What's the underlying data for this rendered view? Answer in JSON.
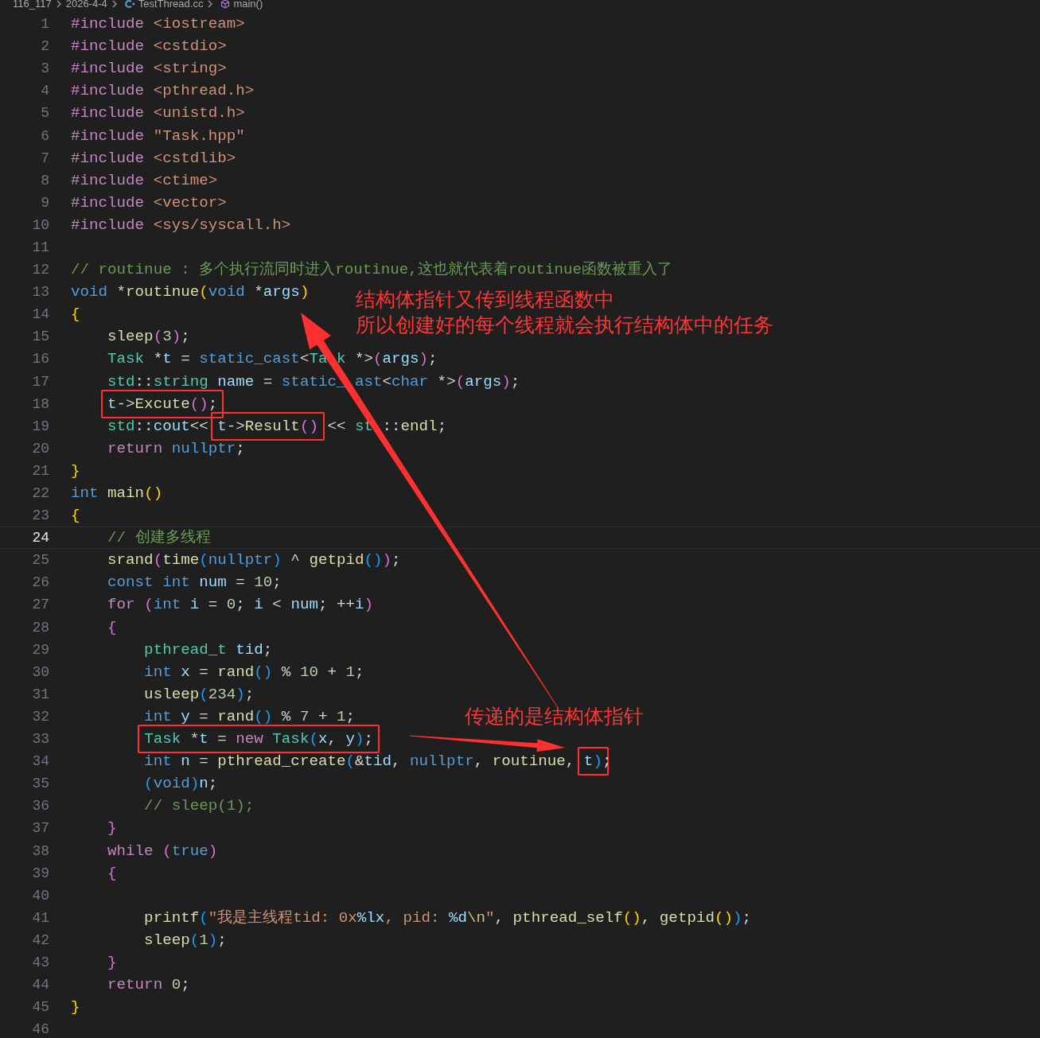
{
  "breadcrumb": [
    {
      "kind": "folder",
      "text": "116_117"
    },
    {
      "kind": "folder",
      "text": "2026-4-4"
    },
    {
      "kind": "file",
      "text": "TestThread.cc"
    },
    {
      "kind": "symbol",
      "text": "main()"
    }
  ],
  "lines": [
    {
      "number": "1",
      "selected": false,
      "tokens": [
        {
          "kind": "control",
          "text": "#include "
        },
        {
          "kind": "string",
          "text": "<iostream>"
        }
      ]
    },
    {
      "number": "2",
      "selected": false,
      "tokens": [
        {
          "kind": "control",
          "text": "#include "
        },
        {
          "kind": "string",
          "text": "<cstdio>"
        }
      ]
    },
    {
      "number": "3",
      "selected": false,
      "tokens": [
        {
          "kind": "control",
          "text": "#include "
        },
        {
          "kind": "string",
          "text": "<string>"
        }
      ]
    },
    {
      "number": "4",
      "selected": false,
      "tokens": [
        {
          "kind": "control",
          "text": "#include "
        },
        {
          "kind": "string",
          "text": "<pthread.h>"
        }
      ]
    },
    {
      "number": "5",
      "selected": false,
      "tokens": [
        {
          "kind": "control",
          "text": "#include "
        },
        {
          "kind": "string",
          "text": "<unistd.h>"
        }
      ]
    },
    {
      "number": "6",
      "selected": false,
      "tokens": [
        {
          "kind": "control",
          "text": "#include "
        },
        {
          "kind": "string",
          "text": "\"Task.hpp\""
        }
      ]
    },
    {
      "number": "7",
      "selected": false,
      "tokens": [
        {
          "kind": "control",
          "text": "#include "
        },
        {
          "kind": "string",
          "text": "<cstdlib>"
        }
      ]
    },
    {
      "number": "8",
      "selected": false,
      "tokens": [
        {
          "kind": "control",
          "text": "#include "
        },
        {
          "kind": "string",
          "text": "<ctime>"
        }
      ]
    },
    {
      "number": "9",
      "selected": false,
      "tokens": [
        {
          "kind": "control",
          "text": "#include "
        },
        {
          "kind": "string",
          "text": "<vector>"
        }
      ]
    },
    {
      "number": "10",
      "selected": false,
      "tokens": [
        {
          "kind": "control",
          "text": "#include "
        },
        {
          "kind": "string",
          "text": "<sys/syscall.h>"
        }
      ]
    },
    {
      "number": "11",
      "selected": false
    },
    {
      "number": "12",
      "selected": false,
      "tokens": [
        {
          "kind": "comment",
          "text": "// routinue : 多个执行流同时进入routinue,这也就代表着routinue函数被重入了"
        }
      ]
    },
    {
      "number": "13",
      "selected": false,
      "tokens": [
        {
          "kind": "keyword",
          "text": "void"
        },
        {
          "kind": "plain",
          "text": " *"
        },
        {
          "kind": "function",
          "text": "routinue"
        },
        {
          "kind": "bracket1",
          "text": "("
        },
        {
          "kind": "keyword",
          "text": "void"
        },
        {
          "kind": "plain",
          "text": " *"
        },
        {
          "kind": "variable",
          "text": "args"
        },
        {
          "kind": "bracket1",
          "text": ")"
        }
      ]
    },
    {
      "number": "14",
      "selected": false,
      "tokens": [
        {
          "kind": "bracket1",
          "text": "{"
        }
      ]
    },
    {
      "number": "15",
      "selected": false,
      "tokens": [
        {
          "kind": "function",
          "text": "    sleep"
        },
        {
          "kind": "bracket2",
          "text": "("
        },
        {
          "kind": "number",
          "text": "3"
        },
        {
          "kind": "bracket2",
          "text": ")"
        },
        {
          "kind": "plain",
          "text": ";"
        }
      ]
    },
    {
      "number": "16",
      "selected": false,
      "tokens": [
        {
          "kind": "type",
          "text": "    Task"
        },
        {
          "kind": "plain",
          "text": " *"
        },
        {
          "kind": "variable",
          "text": "t"
        },
        {
          "kind": "plain",
          "text": " = "
        },
        {
          "kind": "keyword",
          "text": "static_cast"
        },
        {
          "kind": "plain",
          "text": "<"
        },
        {
          "kind": "type",
          "text": "Ta"
        },
        {
          "kind": "type",
          "text": " k"
        },
        {
          "kind": "plain",
          "text": " *>"
        },
        {
          "kind": "bracket2",
          "text": "("
        },
        {
          "kind": "variable",
          "text": "args"
        },
        {
          "kind": "bracket2",
          "text": ")"
        },
        {
          "kind": "plain",
          "text": ";"
        }
      ]
    },
    {
      "number": "17",
      "selected": false,
      "tokens": [
        {
          "kind": "type",
          "text": "    std"
        },
        {
          "kind": "plain",
          "text": "::"
        },
        {
          "kind": "type",
          "text": "string "
        },
        {
          "kind": "variable",
          "text": "name"
        },
        {
          "kind": "plain",
          "text": " = "
        },
        {
          "kind": "keyword",
          "text": "static_"
        },
        {
          "kind": "keyword",
          "text": " ast"
        },
        {
          "kind": "plain",
          "text": "<"
        },
        {
          "kind": "keyword",
          "text": "char"
        },
        {
          "kind": "plain",
          "text": " *>"
        },
        {
          "kind": "bracket2",
          "text": "("
        },
        {
          "kind": "variable",
          "text": "args"
        },
        {
          "kind": "bracket2",
          "text": ")"
        },
        {
          "kind": "plain",
          "text": ";"
        }
      ]
    },
    {
      "number": "18",
      "selected": false,
      "segments": [
        {
          "framed": true,
          "tokens": [
            {
              "kind": "variable",
              "text": "    t"
            },
            {
              "kind": "plain",
              "text": "->"
            },
            {
              "kind": "function",
              "text": "Excute"
            },
            {
              "kind": "bracket2",
              "text": "()"
            },
            {
              "kind": "plain",
              "text": ";"
            }
          ]
        }
      ]
    },
    {
      "number": "19",
      "selected": false,
      "segments": [
        {
          "tokens": [
            {
              "kind": "type",
              "text": "    std"
            },
            {
              "kind": "plain",
              "text": "::"
            },
            {
              "kind": "variable",
              "text": "cout"
            },
            {
              "kind": "plain",
              "text": "<< "
            }
          ]
        },
        {
          "framed": true,
          "tokens": [
            {
              "kind": "variable",
              "text": "t"
            },
            {
              "kind": "plain",
              "text": "->"
            },
            {
              "kind": "function",
              "text": "Result"
            },
            {
              "kind": "bracket2",
              "text": "()"
            }
          ]
        },
        {
          "tokens": [
            {
              "kind": "plain",
              "text": " << "
            },
            {
              "kind": "type",
              "text": "st"
            },
            {
              "kind": "plain",
              "text": " ::"
            },
            {
              "kind": "function",
              "text": "endl"
            },
            {
              "kind": "plain",
              "text": ";"
            }
          ]
        }
      ]
    },
    {
      "number": "20",
      "selected": false,
      "tokens": [
        {
          "kind": "control",
          "text": "    return "
        },
        {
          "kind": "keyword",
          "text": "nullptr"
        },
        {
          "kind": "plain",
          "text": ";"
        }
      ]
    },
    {
      "number": "21",
      "selected": false,
      "tokens": [
        {
          "kind": "bracket1",
          "text": "}"
        }
      ]
    },
    {
      "number": "22",
      "selected": false,
      "tokens": [
        {
          "kind": "keyword",
          "text": "int "
        },
        {
          "kind": "function",
          "text": "main"
        },
        {
          "kind": "bracket1",
          "text": "()"
        }
      ]
    },
    {
      "number": "23",
      "selected": false,
      "tokens": [
        {
          "kind": "bracket1",
          "text": "{"
        }
      ]
    },
    {
      "number": "24",
      "selected": true,
      "tokens": [
        {
          "kind": "comment",
          "text": "    // 创建多线程"
        }
      ]
    },
    {
      "number": "25",
      "selected": false,
      "tokens": [
        {
          "kind": "function",
          "text": "    srand"
        },
        {
          "kind": "bracket2",
          "text": "("
        },
        {
          "kind": "function",
          "text": "time"
        },
        {
          "kind": "bracket3",
          "text": "("
        },
        {
          "kind": "keyword",
          "text": "nullptr"
        },
        {
          "kind": "bracket3",
          "text": ")"
        },
        {
          "kind": "plain",
          "text": " ^ "
        },
        {
          "kind": "function",
          "text": "getpid"
        },
        {
          "kind": "bracket3",
          "text": "()"
        },
        {
          "kind": "bracket2",
          "text": ")"
        },
        {
          "kind": "plain",
          "text": ";"
        }
      ]
    },
    {
      "number": "26",
      "selected": false,
      "tokens": [
        {
          "kind": "keyword",
          "text": "    const "
        },
        {
          "kind": "keyword",
          "text": "int "
        },
        {
          "kind": "variable",
          "text": "num"
        },
        {
          "kind": "plain",
          "text": " = "
        },
        {
          "kind": "number",
          "text": "10"
        },
        {
          "kind": "plain",
          "text": ";"
        }
      ]
    },
    {
      "number": "27",
      "selected": false,
      "tokens": [
        {
          "kind": "control",
          "text": "    for "
        },
        {
          "kind": "bracket2",
          "text": "("
        },
        {
          "kind": "keyword",
          "text": "int "
        },
        {
          "kind": "variable",
          "text": "i"
        },
        {
          "kind": "plain",
          "text": " = "
        },
        {
          "kind": "number",
          "text": "0"
        },
        {
          "kind": "plain",
          "text": "; "
        },
        {
          "kind": "variable",
          "text": "i"
        },
        {
          "kind": "plain",
          "text": " < "
        },
        {
          "kind": "variable",
          "text": "num"
        },
        {
          "kind": "plain",
          "text": "; ++"
        },
        {
          "kind": "variable",
          "text": "i"
        },
        {
          "kind": "bracket2",
          "text": ")"
        }
      ]
    },
    {
      "number": "28",
      "selected": false,
      "tokens": [
        {
          "kind": "bracket2",
          "text": "    {"
        }
      ]
    },
    {
      "number": "29",
      "selected": false,
      "tokens": [
        {
          "kind": "type",
          "text": "        pthread_t "
        },
        {
          "kind": "variable",
          "text": "tid"
        },
        {
          "kind": "plain",
          "text": ";"
        }
      ]
    },
    {
      "number": "30",
      "selected": false,
      "tokens": [
        {
          "kind": "keyword",
          "text": "        int "
        },
        {
          "kind": "variable",
          "text": "x"
        },
        {
          "kind": "plain",
          "text": " = "
        },
        {
          "kind": "function",
          "text": "rand"
        },
        {
          "kind": "bracket3",
          "text": "()"
        },
        {
          "kind": "plain",
          "text": " % "
        },
        {
          "kind": "number",
          "text": "10"
        },
        {
          "kind": "plain",
          "text": " + "
        },
        {
          "kind": "number",
          "text": "1"
        },
        {
          "kind": "plain",
          "text": ";"
        }
      ]
    },
    {
      "number": "31",
      "selected": false,
      "tokens": [
        {
          "kind": "function",
          "text": "        usleep"
        },
        {
          "kind": "bracket3",
          "text": "("
        },
        {
          "kind": "number",
          "text": "234"
        },
        {
          "kind": "bracket3",
          "text": ")"
        },
        {
          "kind": "plain",
          "text": ";"
        }
      ]
    },
    {
      "number": "32",
      "selected": false,
      "tokens": [
        {
          "kind": "keyword",
          "text": "        int "
        },
        {
          "kind": "variable",
          "text": "y"
        },
        {
          "kind": "plain",
          "text": " = "
        },
        {
          "kind": "function",
          "text": "rand"
        },
        {
          "kind": "bracket3",
          "text": "()"
        },
        {
          "kind": "plain",
          "text": " % "
        },
        {
          "kind": "number",
          "text": "7"
        },
        {
          "kind": "plain",
          "text": " + "
        },
        {
          "kind": "number",
          "text": "1"
        },
        {
          "kind": "plain",
          "text": ";"
        }
      ]
    },
    {
      "number": "33",
      "selected": false,
      "segments": [
        {
          "framed": true,
          "tokens": [
            {
              "kind": "type",
              "text": "        Task"
            },
            {
              "kind": "plain",
              "text": " *"
            },
            {
              "kind": "variable",
              "text": "t"
            },
            {
              "kind": "plain",
              "text": " = "
            },
            {
              "kind": "control",
              "text": "new "
            },
            {
              "kind": "type",
              "text": "Task"
            },
            {
              "kind": "bracket3",
              "text": "("
            },
            {
              "kind": "variable",
              "text": "x"
            },
            {
              "kind": "plain",
              "text": ", "
            },
            {
              "kind": "variable",
              "text": "y"
            },
            {
              "kind": "bracket3",
              "text": ")"
            },
            {
              "kind": "plain",
              "text": ";"
            }
          ]
        }
      ]
    },
    {
      "number": "34",
      "selected": false,
      "segments": [
        {
          "tokens": [
            {
              "kind": "keyword",
              "text": "        int "
            },
            {
              "kind": "variable",
              "text": "n"
            },
            {
              "kind": "plain",
              "text": " = "
            },
            {
              "kind": "function",
              "text": "pthread_create"
            },
            {
              "kind": "bracket3",
              "text": "("
            },
            {
              "kind": "plain",
              "text": "&"
            },
            {
              "kind": "variable",
              "text": "tid"
            },
            {
              "kind": "plain",
              "text": ", "
            },
            {
              "kind": "keyword",
              "text": "nullptr"
            },
            {
              "kind": "plain",
              "text": ", "
            },
            {
              "kind": "function",
              "text": "routinue"
            },
            {
              "kind": "plain",
              "text": ", "
            }
          ]
        },
        {
          "framed": true,
          "tokens": [
            {
              "kind": "variable",
              "text": "t"
            },
            {
              "kind": "bracket3",
              "text": ")"
            }
          ]
        },
        {
          "tokens": [
            {
              "kind": "plain",
              "text": ";"
            }
          ]
        }
      ]
    },
    {
      "number": "35",
      "selected": false,
      "tokens": [
        {
          "kind": "bracket3",
          "text": "        ("
        },
        {
          "kind": "keyword",
          "text": "void"
        },
        {
          "kind": "bracket3",
          "text": ")"
        },
        {
          "kind": "variable",
          "text": "n"
        },
        {
          "kind": "plain",
          "text": ";"
        }
      ]
    },
    {
      "number": "36",
      "selected": false,
      "tokens": [
        {
          "kind": "comment",
          "text": "        // sleep(1);"
        }
      ]
    },
    {
      "number": "37",
      "selected": false,
      "tokens": [
        {
          "kind": "bracket2",
          "text": "    }"
        }
      ]
    },
    {
      "number": "38",
      "selected": false,
      "tokens": [
        {
          "kind": "control",
          "text": "    while "
        },
        {
          "kind": "bracket2",
          "text": "("
        },
        {
          "kind": "keyword",
          "text": "true"
        },
        {
          "kind": "bracket2",
          "text": ")"
        }
      ]
    },
    {
      "number": "39",
      "selected": false,
      "tokens": [
        {
          "kind": "bracket2",
          "text": "    {"
        }
      ]
    },
    {
      "number": "40",
      "selected": false
    },
    {
      "number": "41",
      "selected": false,
      "tokens": [
        {
          "kind": "function",
          "text": "        printf"
        },
        {
          "kind": "bracket3",
          "text": "("
        },
        {
          "kind": "string",
          "text": "\"我是主线程tid: 0x"
        },
        {
          "kind": "variable",
          "text": "%lx"
        },
        {
          "kind": "string",
          "text": ", pid: "
        },
        {
          "kind": "variable",
          "text": "%d"
        },
        {
          "kind": "escape",
          "text": "\\n"
        },
        {
          "kind": "string",
          "text": "\""
        },
        {
          "kind": "plain",
          "text": ", "
        },
        {
          "kind": "function",
          "text": "pthread_self"
        },
        {
          "kind": "bracket1",
          "text": "()"
        },
        {
          "kind": "plain",
          "text": ", "
        },
        {
          "kind": "function",
          "text": "getpid"
        },
        {
          "kind": "bracket1",
          "text": "()"
        },
        {
          "kind": "bracket3",
          "text": ")"
        },
        {
          "kind": "plain",
          "text": ";"
        }
      ]
    },
    {
      "number": "42",
      "selected": false,
      "tokens": [
        {
          "kind": "function",
          "text": "        sleep"
        },
        {
          "kind": "bracket3",
          "text": "("
        },
        {
          "kind": "number",
          "text": "1"
        },
        {
          "kind": "bracket3",
          "text": ")"
        },
        {
          "kind": "plain",
          "text": ";"
        }
      ]
    },
    {
      "number": "43",
      "selected": false,
      "tokens": [
        {
          "kind": "bracket2",
          "text": "    }"
        }
      ]
    },
    {
      "number": "44",
      "selected": false,
      "tokens": [
        {
          "kind": "control",
          "text": "    return "
        },
        {
          "kind": "number",
          "text": "0"
        },
        {
          "kind": "plain",
          "text": ";"
        }
      ]
    },
    {
      "number": "45",
      "selected": false,
      "tokens": [
        {
          "kind": "bracket1",
          "text": "}"
        }
      ]
    },
    {
      "number": "46",
      "selected": false
    }
  ],
  "annotations": [
    {
      "lines": [
        "结构体指针又传到线程函数中",
        "所以创建好的每个线程就会执行结构体中的任务"
      ]
    },
    {
      "lines": [
        "传递的是结构体指针"
      ]
    }
  ]
}
